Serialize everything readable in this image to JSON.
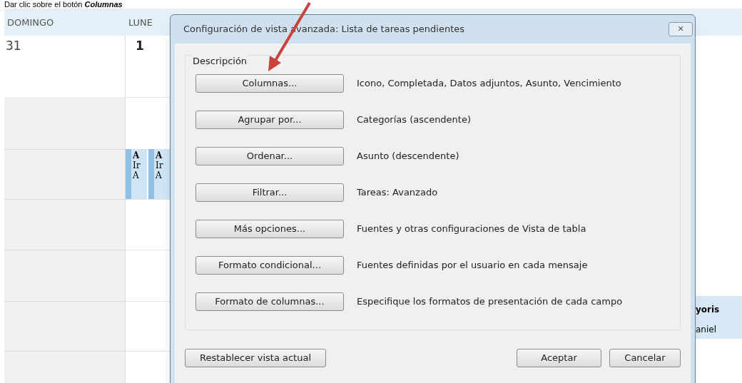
{
  "caption": {
    "text": "Dar clic sobre el botón",
    "emphasis": "Columnas"
  },
  "calendar": {
    "days": [
      {
        "label": "DOMINGO",
        "date": "31",
        "bold": false
      },
      {
        "label": "LUNE",
        "date": "1",
        "bold": true
      }
    ],
    "appointments": [
      {
        "lines": [
          "A",
          "Ir",
          "A"
        ]
      },
      {
        "lines": [
          "A",
          "Ir",
          "A"
        ]
      }
    ],
    "right_event": {
      "title": "yoris",
      "subtitle": "aniel"
    }
  },
  "dialog": {
    "title": "Configuración de vista avanzada: Lista de tareas pendientes",
    "close": "✕",
    "group": "Descripción",
    "rows": [
      {
        "button": "Columnas...",
        "description": "Icono, Completada, Datos adjuntos, Asunto, Vencimiento"
      },
      {
        "button": "Agrupar por...",
        "description": "Categorías (ascendente)"
      },
      {
        "button": "Ordenar...",
        "description": "Asunto (descendente)"
      },
      {
        "button": "Filtrar...",
        "description": "Tareas: Avanzado"
      },
      {
        "button": "Más opciones...",
        "description": "Fuentes y otras configuraciones de Vista de tabla"
      },
      {
        "button": "Formato condicional...",
        "description": "Fuentes definidas por el usuario en cada mensaje"
      },
      {
        "button": "Formato de columnas...",
        "description": "Especifique los formatos de presentación de cada campo"
      }
    ],
    "reset": "Restablecer vista actual",
    "ok": "Aceptar",
    "cancel": "Cancelar"
  }
}
